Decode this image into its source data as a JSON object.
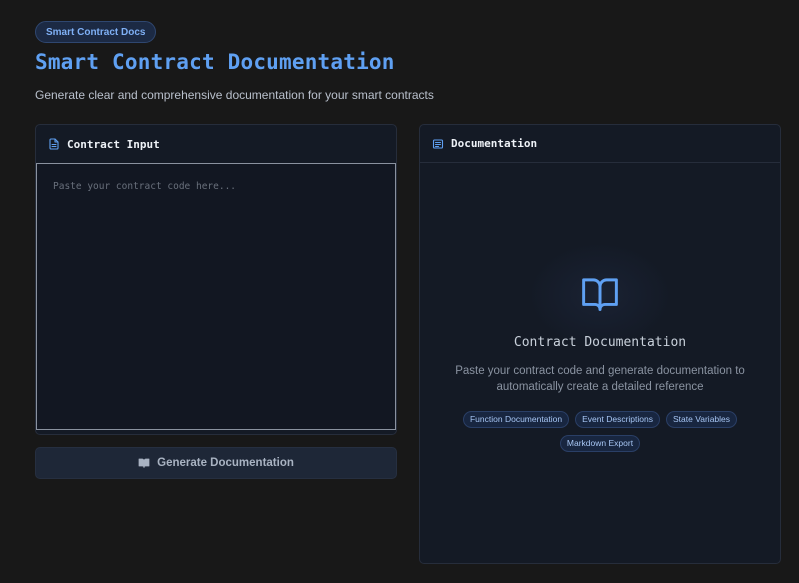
{
  "header": {
    "badge": "Smart Contract Docs",
    "title": "Smart Contract Documentation",
    "subtitle": "Generate clear and comprehensive documentation for your smart contracts"
  },
  "input_panel": {
    "title": "Contract Input",
    "icon": "file-text-icon",
    "placeholder": "Paste your contract code here...",
    "value": ""
  },
  "generate_button": {
    "label": "Generate Documentation",
    "icon": "book-open-icon"
  },
  "output_panel": {
    "title": "Documentation",
    "icon": "list-icon",
    "empty_state": {
      "icon": "book-open-icon",
      "title": "Contract Documentation",
      "description": "Paste your contract code and generate documentation to automatically create a detailed reference",
      "tags": [
        "Function Documentation",
        "Event Descriptions",
        "State Variables",
        "Markdown Export"
      ]
    }
  },
  "colors": {
    "background": "#181818",
    "accent": "#5fa0f2",
    "panel": "#141a25",
    "tag_background": "#182640"
  }
}
